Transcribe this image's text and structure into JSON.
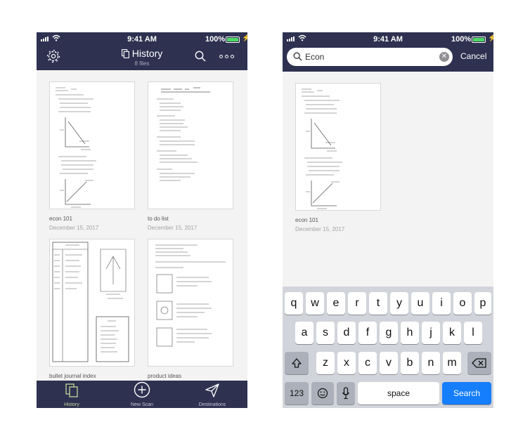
{
  "status_bar": {
    "time": "9:41 AM",
    "battery": "100%"
  },
  "history_screen": {
    "title": "History",
    "subtitle": "8 files",
    "files": [
      {
        "name": "econ 101",
        "date": "December 15, 2017"
      },
      {
        "name": "to do list",
        "date": "December 15, 2017"
      },
      {
        "name": "bullet journal index",
        "date": ""
      },
      {
        "name": "product ideas",
        "date": ""
      }
    ],
    "tabs": [
      {
        "label": "History",
        "icon": "documents-icon"
      },
      {
        "label": "New Scan",
        "icon": "plus-circle-icon"
      },
      {
        "label": "Destinations",
        "icon": "paper-plane-icon"
      }
    ]
  },
  "search_screen": {
    "query": "Econ",
    "cancel_label": "Cancel",
    "results": [
      {
        "name": "econ 101",
        "date": "December 15, 2017"
      }
    ],
    "keyboard": {
      "row1": [
        "q",
        "w",
        "e",
        "r",
        "t",
        "y",
        "u",
        "i",
        "o",
        "p"
      ],
      "row2": [
        "a",
        "s",
        "d",
        "f",
        "g",
        "h",
        "j",
        "k",
        "l"
      ],
      "row3": [
        "z",
        "x",
        "c",
        "v",
        "b",
        "n",
        "m"
      ],
      "numbers_label": "123",
      "space_label": "space",
      "search_label": "Search"
    }
  },
  "colors": {
    "nav_bar": "#2e3150",
    "history_tab_active": "#c3d89a",
    "search_key": "#157efb"
  }
}
